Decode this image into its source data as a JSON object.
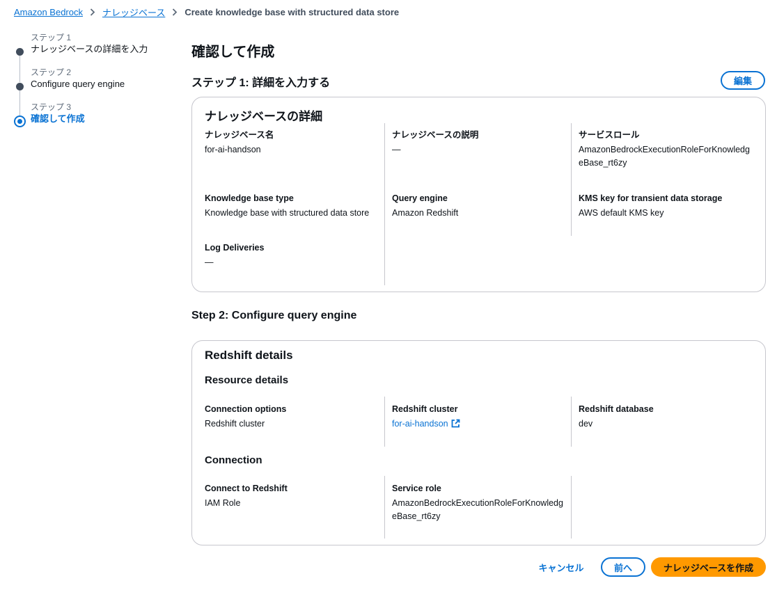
{
  "breadcrumb": {
    "items": [
      "Amazon Bedrock",
      "ナレッジベース"
    ],
    "current": "Create knowledge base with structured data store"
  },
  "stepper": {
    "steps": [
      {
        "number": "ステップ 1",
        "title": "ナレッジベースの詳細を入力"
      },
      {
        "number": "ステップ 2",
        "title": "Configure query engine"
      },
      {
        "number": "ステップ 3",
        "title": "確認して作成"
      }
    ]
  },
  "page": {
    "title": "確認して作成"
  },
  "step1": {
    "heading": "ステップ 1: 詳細を入力する",
    "edit_label": "編集",
    "card": {
      "title": "ナレッジベースの詳細",
      "fields": [
        {
          "label": "ナレッジベース名",
          "value": "for-ai-handson"
        },
        {
          "label": "ナレッジベースの説明",
          "value": "—"
        },
        {
          "label": "サービスロール",
          "value": "AmazonBedrockExecutionRoleForKnowledgeBase_rt6zy"
        },
        {
          "label": "Knowledge base type",
          "value": "Knowledge base with structured data store"
        },
        {
          "label": "Query engine",
          "value": "Amazon Redshift"
        },
        {
          "label": "KMS key for transient data storage",
          "value": "AWS default KMS key"
        },
        {
          "label": "Log Deliveries",
          "value": "—"
        }
      ]
    }
  },
  "step2": {
    "heading": "Step 2: Configure query engine",
    "card": {
      "title": "Redshift details",
      "resource_title": "Resource details",
      "resource_fields": [
        {
          "label": "Connection options",
          "value": "Redshift cluster"
        },
        {
          "label": "Redshift cluster",
          "value": "for-ai-handson"
        },
        {
          "label": "Redshift database",
          "value": "dev"
        }
      ],
      "connection_title": "Connection",
      "connection_fields": [
        {
          "label": "Connect to Redshift",
          "value": "IAM Role"
        },
        {
          "label": "Service role",
          "value": "AmazonBedrockExecutionRoleForKnowledgeBase_rt6zy"
        }
      ]
    }
  },
  "footer": {
    "cancel_label": "キャンセル",
    "previous_label": "前へ",
    "create_label": "ナレッジベースを作成"
  },
  "colors": {
    "link": "#0972d3",
    "primary_button": "#ff9900",
    "border": "#c6c6cd"
  }
}
